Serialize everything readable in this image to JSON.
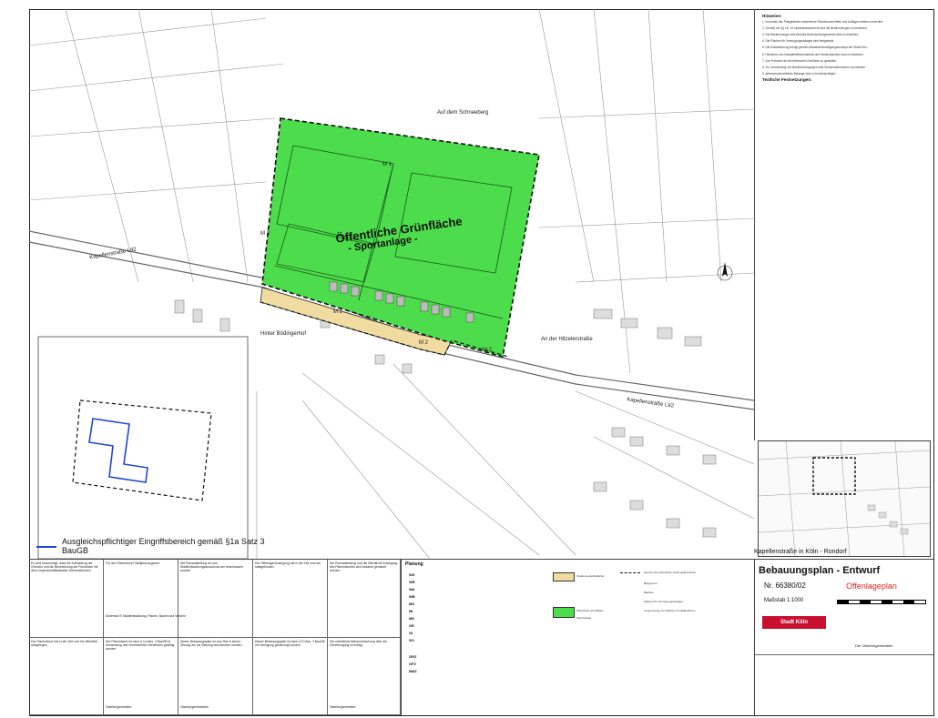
{
  "map": {
    "street_labels": [
      "Auf dem Schneeberg",
      "Kapellenstraße L92",
      "Hinter Bödingerhof",
      "An der Hitzelerstraße",
      "Kapellenstraße L92"
    ],
    "area_title": "Öffentliche Grünfläche",
    "area_subtitle": "- Sportanlage -",
    "markers": [
      "M 1",
      "M 2",
      "M 2",
      "M 2",
      "M 3"
    ],
    "compensation_label": "Ausgleichspflichtiger Eingriffsbereich gemäß §1a Satz 3 BauGB",
    "colors": {
      "green": "#4cdc4c",
      "green_border": "#1a1a1a",
      "yellow": "#f0dca0",
      "blue": "#1e46d2"
    }
  },
  "notes": {
    "heading": "Hinweise:",
    "section2": "Textliche Festsetzungen:",
    "paragraphs": [
      "1. Innerhalb des Plangebietes bestehende Rechtsvorschriften und Auflagen bleiben unberührt.",
      "2. Gemäß der §§ 18, 19 Landeswasserrecht sind die Bestimmungen zu beachten.",
      "3. Die Bestimmungen des Bundes-Bodenschutzgesetzes sind zu beachten.",
      "4. Die Flächen für Versorgungsanlagen sind festgesetzt.",
      "5. Die Entwässerung erfolgt gemäß Abwasserbeseitigungskonzept der Stadt Köln.",
      "6. Hinweise zum Kampfmittelräumdienst und Denkmalschutz sind zu beachten.",
      "7. Der Freiraum ist mit heimischen Gehölzen zu gestalten.",
      "8. Zur Vermeidung von Beeinträchtigungen sind Schutzmaßnahmen vorzusehen.",
      "9. Artenschutzrechtliche Belange sind zu berücksichtigen."
    ]
  },
  "title_block": {
    "location": "Kapellenstraße in Köln - Rondorf",
    "plan_title": "Bebauungsplan - Entwurf",
    "plan_number": "Nr. 66380/02",
    "status": "Offenlageplan",
    "scale": "Maßstab 1:1000",
    "city": "Stadt Köln",
    "footer": "Der Oberbürgermeister"
  },
  "procedure": {
    "cells": [
      "Es wird bescheinigt, dass die Darstellung der Grenzen und die Bezeichnung der Flurstücke mit dem Liegenschaftskataster übereinstimmen.",
      "Für den Planentwurf Stadtplanungsamt",
      "Die Planaufstellung ist vom Stadtentwicklungsausschuss am beschlossen worden.",
      "Die Offenlage/Auslegung hat in der Zeit vom bis stattgefunden.",
      "Die Planaufstellung und die öffentliche Auslegung des Planentwurfes sind bekannt gemacht worden.",
      "Der Planentwurf hat in der Zeit vom bis öffentlich ausgelegen.",
      "Der Planentwurf ist nach § 4 a Abs. 3 BauGB in Anwendung des vereinfachten Verfahrens gebilligt worden.",
      "Dieser Bebauungsplan ist vom Rat in seiner Sitzung am als Satzung beschlossen worden.",
      "Dieser Bebauungsplan ist nach § 10 Abs. 3 BauGB mit Verfügung genehmigt worden.",
      "Die ortsübliche Bekanntmachung über die Genehmigung ist erfolgt."
    ],
    "signers": [
      "Dezernat VI Stadtentwicklung, Planen, Bauen und Verkehr",
      "Oberbürgermeister",
      "Oberbürgermeisterin",
      "Oberbürgermeister"
    ]
  },
  "legend": {
    "title": "Planung",
    "keys": [
      "WS",
      "WR",
      "WA",
      "WB",
      "MD",
      "MI",
      "MK",
      "GE",
      "GI",
      "SO",
      "GRZ",
      "GFZ",
      "BMZ"
    ],
    "items": [
      "Öffentliche Grünfläche",
      "Sportanlage",
      "Straßenverkehrsfläche",
      "Grenze des räumlichen Geltungsbereiches",
      "Baugrenze",
      "Baulinie",
      "Flächen für Versorgungsanlagen",
      "Umgrenzung von Flächen für Maßnahmen"
    ]
  }
}
